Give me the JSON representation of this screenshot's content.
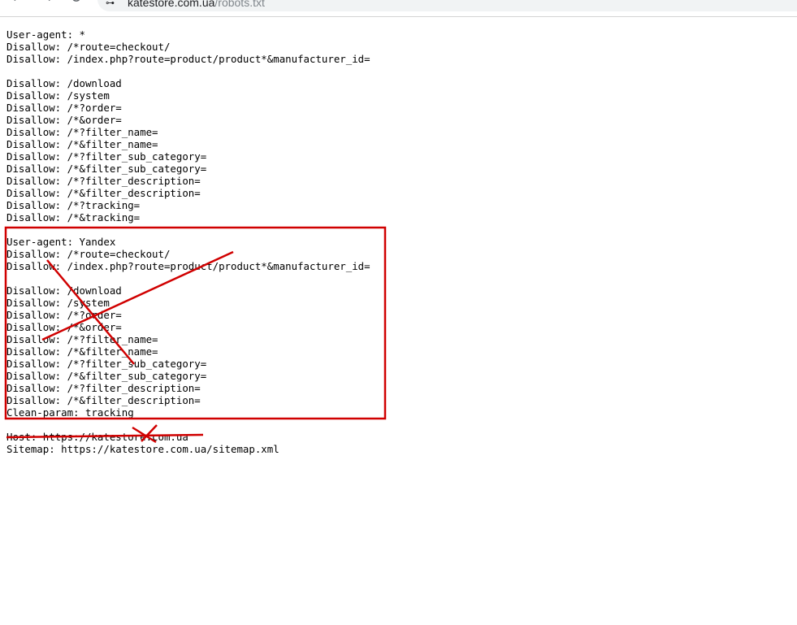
{
  "browser": {
    "address_host": "katestore.com.ua",
    "address_path": "/robots.txt"
  },
  "robots_lines": [
    "User-agent: *",
    "Disallow: /*route=checkout/",
    "Disallow: /index.php?route=product/product*&manufacturer_id=",
    "",
    "Disallow: /download",
    "Disallow: /system",
    "Disallow: /*?order=",
    "Disallow: /*&order=",
    "Disallow: /*?filter_name=",
    "Disallow: /*&filter_name=",
    "Disallow: /*?filter_sub_category=",
    "Disallow: /*&filter_sub_category=",
    "Disallow: /*?filter_description=",
    "Disallow: /*&filter_description=",
    "Disallow: /*?tracking=",
    "Disallow: /*&tracking=",
    "",
    "User-agent: Yandex",
    "Disallow: /*route=checkout/",
    "Disallow: /index.php?route=product/product*&manufacturer_id=",
    "",
    "Disallow: /download",
    "Disallow: /system",
    "Disallow: /*?order=",
    "Disallow: /*&order=",
    "Disallow: /*?filter_name=",
    "Disallow: /*&filter_name=",
    "Disallow: /*?filter_sub_category=",
    "Disallow: /*&filter_sub_category=",
    "Disallow: /*?filter_description=",
    "Disallow: /*&filter_description=",
    "Clean-param: tracking",
    "",
    "Host: https://katestore.com.ua",
    "Sitemap: https://katestore.com.ua/sitemap.xml"
  ],
  "annotation_color": "#d00000"
}
